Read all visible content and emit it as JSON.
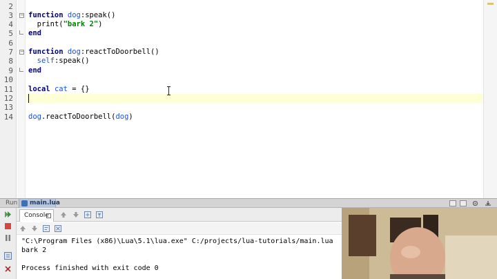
{
  "editor": {
    "line_numbers": [
      "2",
      "3",
      "4",
      "5",
      "6",
      "7",
      "8",
      "9",
      "10",
      "11",
      "12",
      "13",
      "14"
    ],
    "lines": {
      "l3_kw": "function",
      "l3_obj": "dog",
      "l3_rest": ":speak()",
      "l4_indent": "  ",
      "l4_fn": "print(",
      "l4_str": "\"bark 2\"",
      "l4_close": ")",
      "l5_kw": "end",
      "l7_kw": "function",
      "l7_obj": "dog",
      "l7_rest": ":reactToDoorbell()",
      "l8_indent": "  ",
      "l8_self": "self",
      "l8_rest": ":speak()",
      "l9_kw": "end",
      "l11_kw": "local",
      "l11_var": "cat",
      "l11_rest": " = {}",
      "l14_a": "dog",
      "l14_b": ".reactToDoorbell(",
      "l14_c": "dog",
      "l14_d": ")"
    }
  },
  "run_panel": {
    "label": "Run",
    "tab_label": "main.lua"
  },
  "console": {
    "tab_label": "Console",
    "output": [
      "\"C:\\Program Files (x86)\\Lua\\5.1\\lua.exe\" C:/projects/lua-tutorials/main.lua",
      "bark 2",
      "",
      "Process finished with exit code 0"
    ]
  },
  "colors": {
    "keyword": "#000080",
    "entity": "#1750eb",
    "string": "#008000",
    "current_line": "#ffffd7",
    "run_tab": "#b9c6db"
  },
  "icons": {
    "run_tools": [
      "rerun-icon",
      "stop-icon",
      "pause-icon",
      "settings-icon",
      "close-icon"
    ],
    "console_tools": [
      "up-arrow-icon",
      "down-arrow-icon",
      "export-icon",
      "filter-icon"
    ]
  }
}
